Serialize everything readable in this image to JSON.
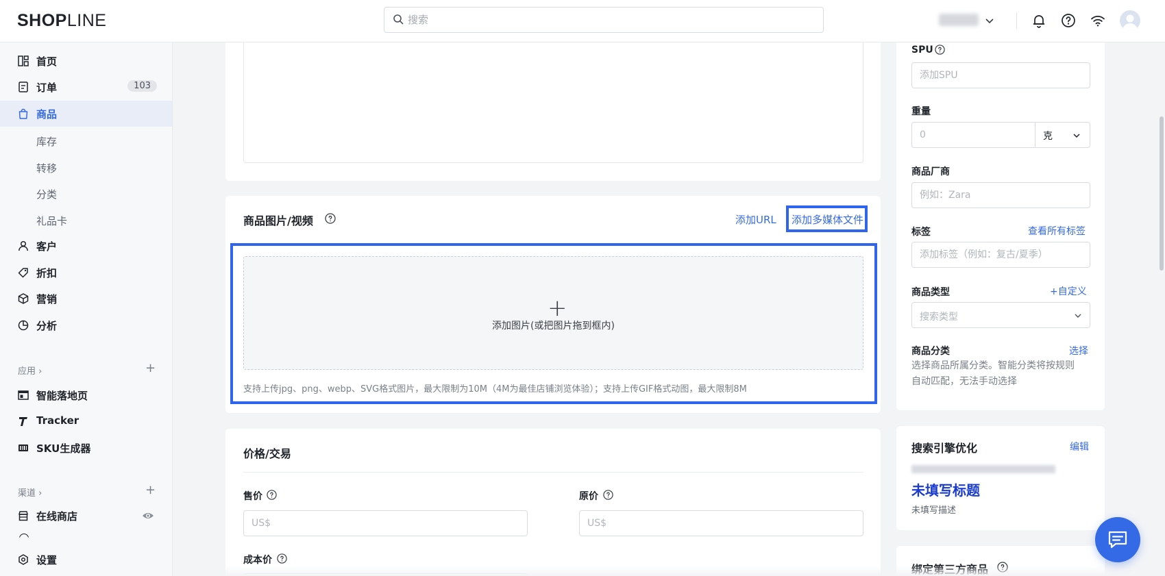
{
  "header": {
    "logo_strong": "SHOP",
    "logo_light": "LINE",
    "search_placeholder": "搜索"
  },
  "sidebar": {
    "items": [
      {
        "label": "首页"
      },
      {
        "label": "订单",
        "badge": "103"
      },
      {
        "label": "商品",
        "active": true
      },
      {
        "label": "客户"
      },
      {
        "label": "折扣"
      },
      {
        "label": "营销"
      },
      {
        "label": "分析"
      }
    ],
    "product_sub": [
      "库存",
      "转移",
      "分类",
      "礼品卡"
    ],
    "apps_label": "应用 ›",
    "apps": [
      "智能落地页",
      "Tracker",
      "SKU生成器"
    ],
    "channels_label": "渠道 ›",
    "channels": [
      "在线商店"
    ],
    "settings": "设置"
  },
  "media": {
    "title": "商品图片/视频",
    "add_url": "添加URL",
    "add_media": "添加多媒体文件",
    "dropzone_plus": "+",
    "dropzone_text": "添加图片(或把图片拖到框内)",
    "hint": "支持上传jpg、png、webp、SVG格式图片，最大限制为10M（4M为最佳店铺浏览体验）；支持上传GIF格式动图，最大限制8M"
  },
  "price": {
    "title": "价格/交易",
    "sale_label": "售价",
    "original_label": "原价",
    "cost_label": "成本价",
    "currency_placeholder": "US$"
  },
  "right": {
    "spu_label": "SPU",
    "spu_placeholder": "添加SPU",
    "weight_label": "重量",
    "weight_placeholder": "0",
    "weight_unit": "克",
    "vendor_label": "商品厂商",
    "vendor_placeholder": "例如：Zara",
    "tags_label": "标签",
    "tags_link": "查看所有标签",
    "tags_placeholder": "添加标签（例如：复古/夏季）",
    "type_label": "商品类型",
    "type_link": "+自定义",
    "type_placeholder": "搜索类型",
    "category_label": "商品分类",
    "category_link": "选择",
    "category_desc_1": "选择商品所属分类。智能分类将按规则",
    "category_desc_2": "自动匹配，无法手动选择",
    "seo_title": "搜索引擎优化",
    "seo_edit": "编辑",
    "seo_page_title": "未填写标题",
    "seo_page_desc": "未填写描述",
    "third_party_title": "绑定第三方商品"
  },
  "colors": {
    "accent": "#356ae6",
    "highlight": "#2f64ef",
    "seo_title": "#1a3bd1"
  }
}
